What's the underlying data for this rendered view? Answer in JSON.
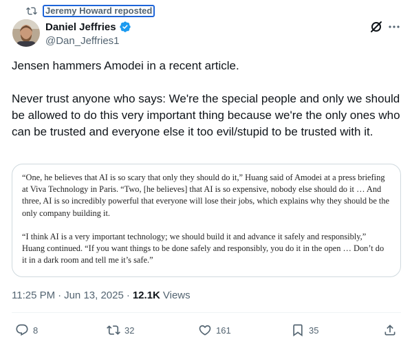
{
  "repost": {
    "label": "Jeremy Howard reposted"
  },
  "author": {
    "display_name": "Daniel Jeffries",
    "handle": "@Dan_Jeffries1"
  },
  "tweet": {
    "paragraph_1": "Jensen hammers Amodei in a recent article.",
    "paragraph_2": "Never trust anyone who says: We're the special people and only we should be allowed to do this very important thing because we're the only ones who can be trusted and everyone else it too evil/stupid to be trusted with it."
  },
  "quote": {
    "paragraph_1": "“One, he believes that AI is so scary that only they should do it,” Huang said of Amodei at a press briefing at Viva Technology in Paris. “Two, [he believes] that AI is so expensive, nobody else should do it … And three, AI is so incredibly powerful that everyone will lose their jobs, which explains why they should be the only company building it.",
    "paragraph_2": "“I think AI is a very important technology; we should build it and advance it safely and responsibly,” Huang continued. “If you want things to be done safely and responsibly, you do it in the open … Don’t do it in a dark room and tell me it’s safe.”"
  },
  "meta": {
    "time": "11:25 PM",
    "separator": "·",
    "date": "Jun 13, 2025",
    "separator_2": "·",
    "views_count": "12.1K",
    "views_label": "Views"
  },
  "actions": {
    "replies": "8",
    "reposts": "32",
    "likes": "161",
    "bookmarks": "35"
  },
  "colors": {
    "text_primary": "#0f1419",
    "text_secondary": "#536471",
    "verified": "#1d9bf0",
    "border": "#cfd9de",
    "focus_outline": "#1d64d8"
  },
  "icons": {
    "repost": "repost-icon",
    "verified": "verified-badge-icon",
    "grok": "grok-icon",
    "more": "more-icon",
    "reply": "reply-icon",
    "like": "heart-icon",
    "bookmark": "bookmark-icon",
    "share": "share-icon"
  }
}
